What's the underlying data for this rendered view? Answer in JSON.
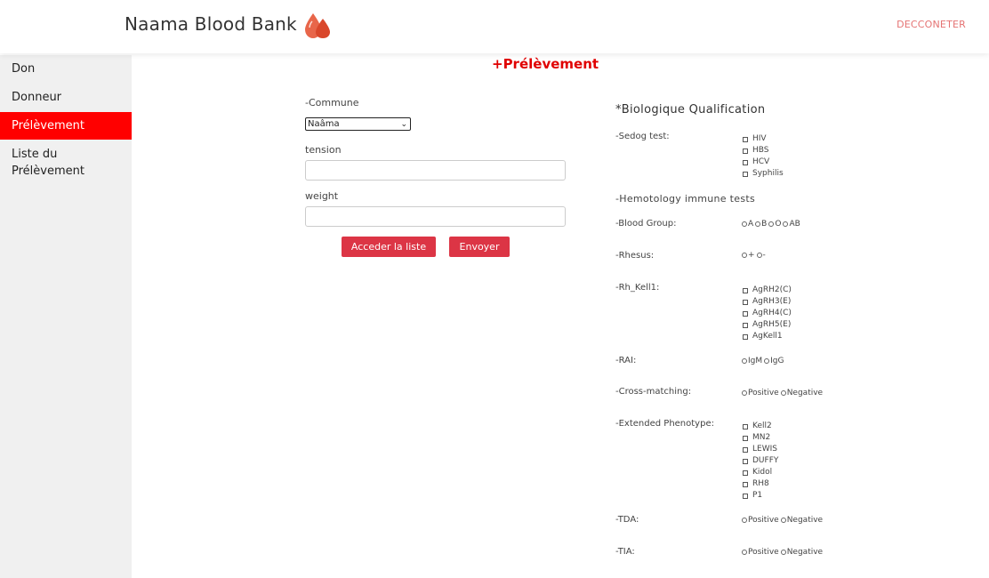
{
  "header": {
    "brand": "Naama Blood Bank",
    "logout": "DECCONETER"
  },
  "sidebar": {
    "items": [
      {
        "label": "Don"
      },
      {
        "label": "Donneur"
      },
      {
        "label": "Prélèvement"
      },
      {
        "label": "Liste du Prélèvement"
      }
    ]
  },
  "form": {
    "title": "+Prélèvement",
    "commune_label": "-Commune",
    "commune_value": "Naâma",
    "tension_label": "tension",
    "weight_label": "weight",
    "btn_list": "Acceder la liste",
    "btn_send": "Envoyer"
  },
  "bio": {
    "title": "*Biologique Qualification",
    "sedog_label": "-Sedog test:",
    "sedog_options": [
      "HIV",
      "HBS",
      "HCV",
      "Syphilis"
    ],
    "hemo_label": "-Hemotology immune tests",
    "blood_group_label": "-Blood Group:",
    "blood_group_options": [
      "A",
      "B",
      "O",
      "AB"
    ],
    "rhesus_label": "-Rhesus:",
    "rhesus_options": [
      "+",
      "-"
    ],
    "rh_kell_label": "-Rh_Kell1:",
    "rh_kell_options": [
      "AgRH2(C)",
      "AgRH3(E)",
      "AgRH4(C)",
      "AgRH5(E)",
      "AgKell1"
    ],
    "rai_label": "-RAI:",
    "rai_options": [
      "IgM",
      "IgG"
    ],
    "cross_label": "-Cross-matching:",
    "cross_options": [
      "Positive",
      "Negative"
    ],
    "ext_label": "-Extended Phenotype:",
    "ext_options": [
      "Kell2",
      "MN2",
      "LEWIS",
      "DUFFY",
      "Kidol",
      "RH8",
      "P1"
    ],
    "tda_label": "-TDA:",
    "tda_options": [
      "Positive",
      "Negative"
    ],
    "tia_label": "-TIA:",
    "tia_options": [
      "Positive",
      "Negative"
    ]
  },
  "colors": {
    "accent": "#ff0000",
    "button": "#dc3545",
    "logout": "#e57373",
    "sidebar_bg": "#f0f0f0"
  }
}
